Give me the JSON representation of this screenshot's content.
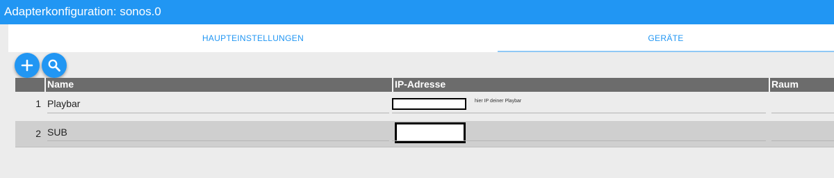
{
  "window": {
    "title": "Adapterkonfiguration: sonos.0"
  },
  "tabs": [
    {
      "label": "HAUPTEINSTELLUNGEN"
    },
    {
      "label": "GERÄTE"
    }
  ],
  "toolbar": {
    "add_icon": "plus-icon",
    "search_icon": "search-icon"
  },
  "table": {
    "columns": [
      "Name",
      "IP-Adresse",
      "Raum"
    ],
    "rows": [
      {
        "index": "1",
        "name": "Playbar",
        "ip": "",
        "hint": "hier IP deiner Playbar",
        "room": ""
      },
      {
        "index": "2",
        "name": "SUB",
        "ip": "",
        "hint": "",
        "room": ""
      }
    ]
  },
  "colors": {
    "accent": "#2196f3",
    "header_bg": "#6c6c6c",
    "row_alt": "#cfcfcf",
    "page_bg": "#ececec"
  }
}
